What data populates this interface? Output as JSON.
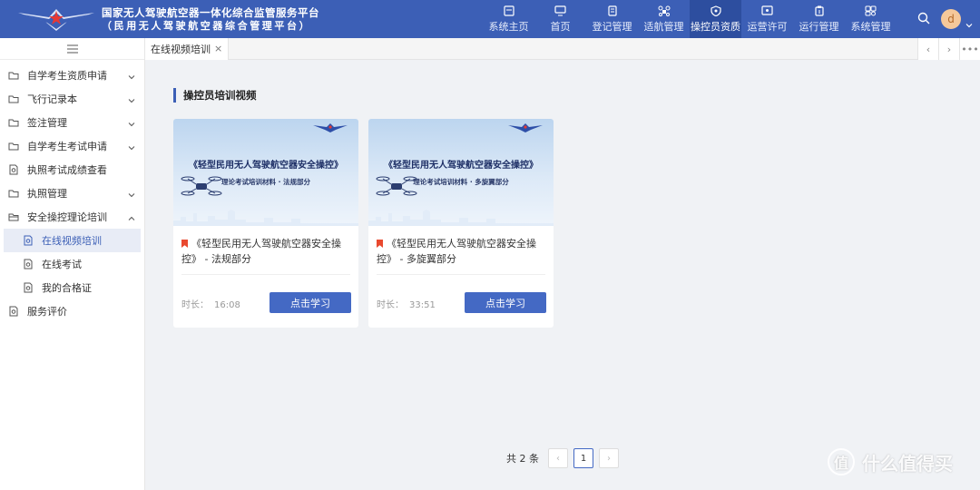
{
  "header": {
    "title_line1": "国家无人驾驶航空器一体化综合监管服务平台",
    "title_line2": "（民用无人驾驶航空器综合管理平台）",
    "nav": [
      {
        "label": "系统主页",
        "icon": "home-page-icon"
      },
      {
        "label": "首页",
        "icon": "monitor-icon"
      },
      {
        "label": "登记管理",
        "icon": "register-icon"
      },
      {
        "label": "适航管理",
        "icon": "drone-icon"
      },
      {
        "label": "操控员资质",
        "icon": "shield-icon"
      },
      {
        "label": "运营许可",
        "icon": "license-icon"
      },
      {
        "label": "运行管理",
        "icon": "clipboard-icon"
      },
      {
        "label": "系统管理",
        "icon": "settings-icon"
      }
    ],
    "active_nav": "操控员资质",
    "avatar_letter": "d",
    "colors": {
      "header_bg": "#3c5fb6",
      "accent": "#4469c4",
      "active_nav_bg": "#2d4e9f"
    }
  },
  "sidebar": {
    "items": [
      {
        "label": "自学考生资质申请",
        "icon": "folder-icon",
        "has_arrow": true
      },
      {
        "label": "飞行记录本",
        "icon": "folder-icon",
        "has_arrow": true
      },
      {
        "label": "签注管理",
        "icon": "folder-icon",
        "has_arrow": true
      },
      {
        "label": "自学考生考试申请",
        "icon": "folder-icon",
        "has_arrow": true
      },
      {
        "label": "执照考试成绩查看",
        "icon": "file-search-icon",
        "has_arrow": false
      },
      {
        "label": "执照管理",
        "icon": "folder-icon",
        "has_arrow": true
      },
      {
        "label": "安全操控理论培训",
        "icon": "folder-open-icon",
        "has_arrow": true
      },
      {
        "label": "在线视频培训",
        "icon": "file-search-icon",
        "sub": true,
        "active": true
      },
      {
        "label": "在线考试",
        "icon": "file-search-icon",
        "sub": true
      },
      {
        "label": "我的合格证",
        "icon": "file-search-icon",
        "sub": true
      },
      {
        "label": "服务评价",
        "icon": "file-search-icon",
        "has_arrow": false
      }
    ]
  },
  "tabs": [
    {
      "label": "在线视频培训",
      "close": "×"
    }
  ],
  "tab_controls": [
    "‹",
    "›",
    "•••"
  ],
  "main": {
    "section_title": "操控员培训视频",
    "cards": [
      {
        "cover_title": "《轻型民用无人驾驶航空器安全操控》",
        "cover_subtitle": "理论考试培训材料 · 法规部分",
        "name": "《轻型民用无人驾驶航空器安全操控》 - 法规部分",
        "duration_label": "时长：",
        "duration": "16:08",
        "button": "点击学习"
      },
      {
        "cover_title": "《轻型民用无人驾驶航空器安全操控》",
        "cover_subtitle": "理论考试培训材料 · 多旋翼部分",
        "name": "《轻型民用无人驾驶航空器安全操控》 - 多旋翼部分",
        "duration_label": "时长：",
        "duration": "33:51",
        "button": "点击学习"
      }
    ]
  },
  "pagination": {
    "total": "共 2 条",
    "prev": "‹",
    "current": "1",
    "next": "›"
  },
  "watermark": {
    "text": "什么值得买",
    "icon": "值"
  }
}
